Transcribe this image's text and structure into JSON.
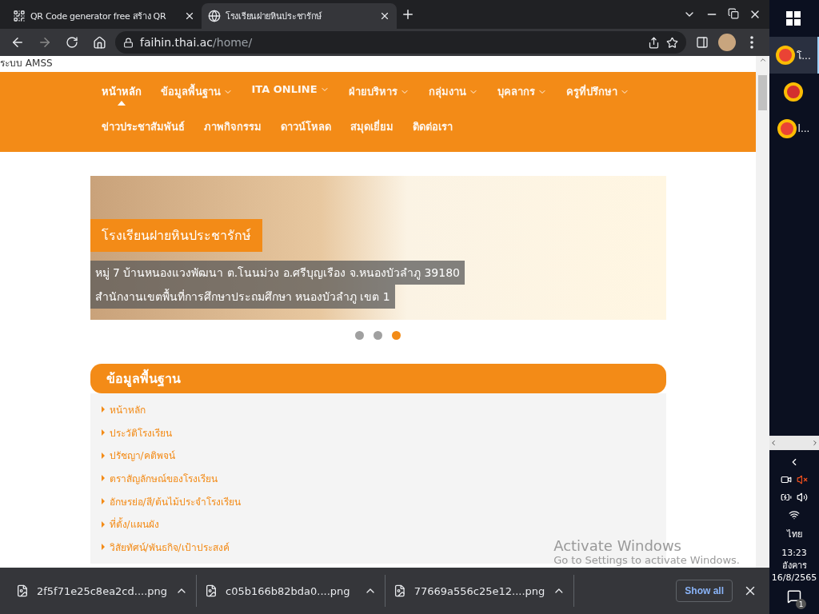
{
  "browser": {
    "tabs": [
      {
        "title": "QR Code generator free สร้าง QR",
        "kind": "qr",
        "selected": false
      },
      {
        "title": "โรงเรียนฝายหินประชารักษ์",
        "kind": "globe",
        "selected": true
      }
    ],
    "url": {
      "host": "faihin.thai.ac",
      "path": "/home/"
    }
  },
  "page": {
    "top_link": "ระบบ AMSS",
    "nav_rows": [
      [
        {
          "label": "หน้าหลัก",
          "dropdown": false,
          "selected": true
        },
        {
          "label": "ข้อมูลพื้นฐาน",
          "dropdown": true,
          "selected": false
        },
        {
          "label": "ITA ONLINE",
          "dropdown": true,
          "selected": false
        },
        {
          "label": "ฝ่ายบริหาร",
          "dropdown": true,
          "selected": false
        },
        {
          "label": "กลุ่มงาน",
          "dropdown": true,
          "selected": false
        },
        {
          "label": "บุคลากร",
          "dropdown": true,
          "selected": false
        },
        {
          "label": "ครูที่ปรึกษา",
          "dropdown": true,
          "selected": false
        }
      ],
      [
        {
          "label": "ข่าวประชาสัมพันธ์",
          "dropdown": false,
          "selected": false
        },
        {
          "label": "ภาพกิจกรรม",
          "dropdown": false,
          "selected": false
        },
        {
          "label": "ดาวน์โหลด",
          "dropdown": false,
          "selected": false
        },
        {
          "label": "สมุดเยี่ยม",
          "dropdown": false,
          "selected": false
        },
        {
          "label": "ติดต่อเรา",
          "dropdown": false,
          "selected": false
        }
      ]
    ],
    "slider": {
      "title": "โรงเรียนฝายหินประชารักษ์",
      "captions": [
        "หมู่ 7 บ้านหนองแวงพัฒนา ต.โนนม่วง อ.ศรีบุญเรือง จ.หนองบัวลำภู 39180",
        "สำนักงานเขตพื้นที่การศึกษาประถมศึกษา หนองบัวลำภู เขต 1"
      ],
      "dots": [
        {
          "selected": false
        },
        {
          "selected": false
        },
        {
          "selected": true
        }
      ]
    },
    "section": {
      "title": "ข้อมูลพื้นฐาน",
      "items": [
        "หน้าหลัก",
        "ประวัติโรงเรียน",
        "ปรัชญา/คติพจน์",
        "ตราสัญลักษณ์ของโรงเรียน",
        "อักษรย่อ/สี/ต้นไม้ประจำโรงเรียน",
        "ที่ตั้ง/แผนผัง",
        "วิสัยทัศน์/พันธกิจ/เป้าประสงค์"
      ]
    },
    "os_notice": {
      "title": "Activate Windows",
      "text": "Go to Settings to activate Windows."
    }
  },
  "downloads": {
    "files": [
      "2f5f71e25c8ea2cd....png",
      "c05b166b82bda0....png",
      "77669a556c25e12....png"
    ],
    "show_all": "Show all"
  },
  "taskbar": {
    "apps": [
      {
        "kind": "chrome",
        "label": "โ...",
        "selected": true
      },
      {
        "kind": "ccleaner",
        "selected": false
      },
      {
        "kind": "chrome",
        "label": "l...",
        "selected": false
      }
    ],
    "language": "ไทย",
    "time": "13:23",
    "day": "อังคาร",
    "date": "16/8/2565",
    "notifications": "1"
  }
}
